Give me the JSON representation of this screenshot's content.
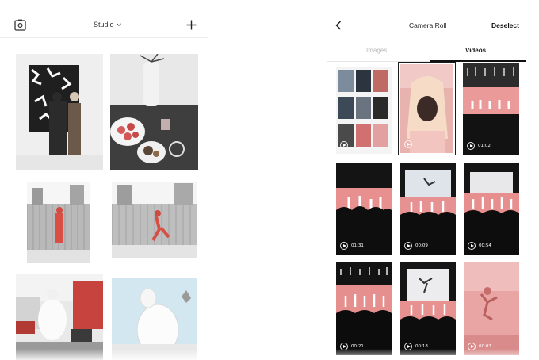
{
  "left_panel": {
    "header": {
      "studio_label": "Studio",
      "icons": [
        "camera-square-icon",
        "chevron-down-icon",
        "plus-icon"
      ]
    }
  },
  "right_panel": {
    "header": {
      "title": "Camera Roll",
      "deselect_label": "Deselect",
      "icons": [
        "back-arrow-icon"
      ]
    },
    "tabs": [
      {
        "label": "Images",
        "active": false
      },
      {
        "label": "Videos",
        "active": true
      }
    ],
    "videos": [
      {
        "duration": "",
        "selected": false
      },
      {
        "duration": "",
        "selected": true
      },
      {
        "duration": "01:02",
        "selected": false
      },
      {
        "duration": "01:31",
        "selected": false
      },
      {
        "duration": "00:09",
        "selected": false
      },
      {
        "duration": "00:54",
        "selected": false
      },
      {
        "duration": "00:21",
        "selected": false
      },
      {
        "duration": "00:18",
        "selected": false
      },
      {
        "duration": "00:03",
        "selected": false
      }
    ]
  },
  "colors": {
    "accent_pink": "#e98c8c",
    "text_dark": "#222222",
    "tab_inactive": "#b5b5b5",
    "divider": "#ececec"
  }
}
